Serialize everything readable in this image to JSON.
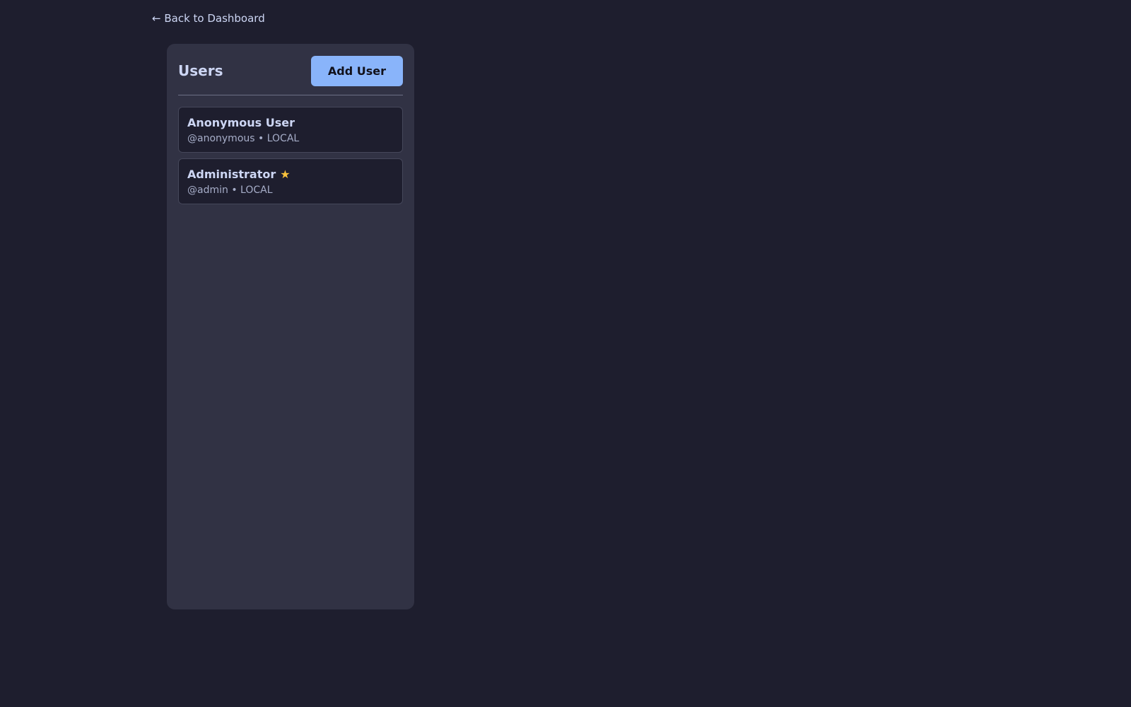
{
  "nav": {
    "back_label": "← Back to Dashboard"
  },
  "panel": {
    "title": "Users",
    "add_button_label": "Add User"
  },
  "users": [
    {
      "name": "Anonymous User",
      "handle": "@anonymous",
      "separator": "•",
      "source": "LOCAL",
      "badge": ""
    },
    {
      "name": "Administrator",
      "handle": "@admin",
      "separator": "•",
      "source": "LOCAL",
      "badge": "star-icon"
    }
  ],
  "colors": {
    "background": "#1e1e2e",
    "panel": "#313244",
    "accent": "#89b4fa",
    "star": "#f9c23c"
  }
}
